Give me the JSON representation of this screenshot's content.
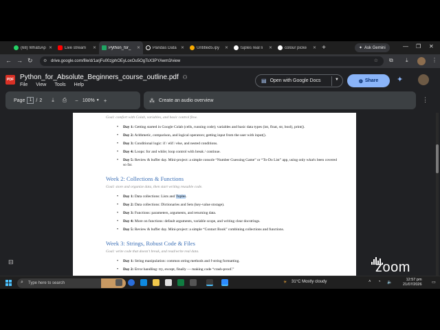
{
  "browser": {
    "tabs": [
      {
        "label": "(68) WhatsAp",
        "color": "#25d366"
      },
      {
        "label": "Live stream",
        "color": "#ff0000"
      },
      {
        "label": "Python_for_",
        "color": "#1fa463",
        "active": true
      },
      {
        "label": "Pandas Data",
        "color": "#ffffff"
      },
      {
        "label": "Untitled5.ipy",
        "color": "#f9ab00"
      },
      {
        "label": "tuples real li",
        "color": "#ffffff"
      },
      {
        "label": "colour picke",
        "color": "#ffffff"
      }
    ],
    "new_tab": "+",
    "ask_gemini": "Ask Gemini",
    "url": "drive.google.com/file/d/1arjFu00zjphOEyLoxOu5OgTsX3PYAwm3/view"
  },
  "viewer": {
    "badge": "PDF",
    "title": "Python_for_Absolute_Beginners_course_outline.pdf",
    "menu": [
      "File",
      "View",
      "Tools",
      "Help"
    ],
    "open_with": "Open with Google Docs",
    "share": "Share",
    "page_label": "Page",
    "page_current": "1",
    "page_sep": "/",
    "page_total": "2",
    "zoom": "100%",
    "audio": "Create an audio overview"
  },
  "document": {
    "top_goal": "Goal: comfort with Colab, variables, and basic control flow.",
    "week1_items": [
      {
        "day": "Day 1:",
        "text": "Getting started in Google Colab (cells, running code); variables and basic data types (int, float, str, bool), print()."
      },
      {
        "day": "Day 2:",
        "text": "Arithmetic, comparison, and logical operators; getting input from the user with input()."
      },
      {
        "day": "Day 3:",
        "text": "Conditional logic: if / elif / else, and nested conditions."
      },
      {
        "day": "Day 4:",
        "text": "Loops: for and while; loop control with break / continue."
      },
      {
        "day": "Day 5:",
        "text": "Review & buffer day. Mini-project: a simple console “Number Guessing Game” or “To-Do List” app, using only what's been covered so far."
      }
    ],
    "week2_title": "Week 2: Collections & Functions",
    "week2_goal": "Goal: store and organize data, then start writing reusable code.",
    "week2_items": [
      {
        "day": "Day 1:",
        "text_a": "Data collections: Lists and ",
        "text_hl": "Tuples",
        "text_b": "."
      },
      {
        "day": "Day 2:",
        "text": "Data collections: Dictionaries and Sets (key-value storage)."
      },
      {
        "day": "Day 3:",
        "text": "Functions: parameters, arguments, and returning data."
      },
      {
        "day": "Day 4:",
        "text": "More on functions: default arguments, variable scope, and writing clear docstrings."
      },
      {
        "day": "Day 5:",
        "text": "Review & buffer day. Mini-project: a simple “Contact Book” combining collections and functions."
      }
    ],
    "week3_title": "Week 3: Strings, Robust Code & Files",
    "week3_goal": "Goal: write code that doesn't break, and read/write real data.",
    "week3_items": [
      {
        "day": "Day 1:",
        "text": "String manipulation: common string methods and f-string formatting."
      },
      {
        "day": "Day 2:",
        "text": "Error handling: try, except, finally — making code “crash-proof.”"
      }
    ]
  },
  "overlay": {
    "zoom_logo": "zoom"
  },
  "taskbar": {
    "search_placeholder": "Type here to search",
    "weather": "31°C  Mostly cloudy",
    "time": "12:57 pm",
    "date": "21/07/2026"
  }
}
